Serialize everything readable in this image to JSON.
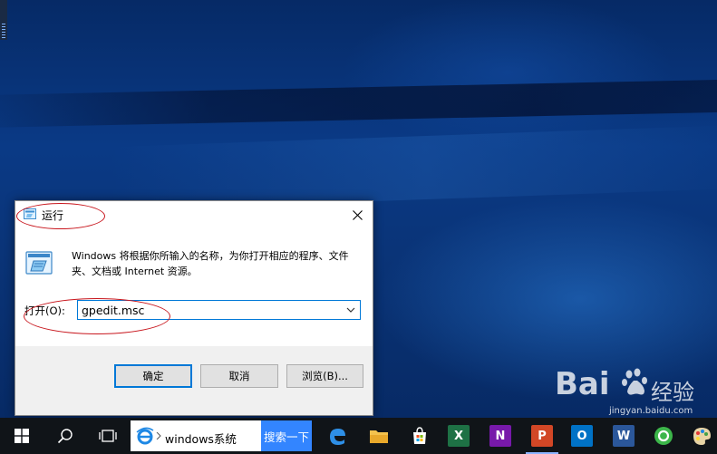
{
  "dialog": {
    "title": "运行",
    "description": "Windows 将根据你所输入的名称，为你打开相应的程序、文件夹、文档或 Internet 资源。",
    "open_label": "打开(O):",
    "command_value": "gpedit.msc",
    "buttons": {
      "ok": "确定",
      "cancel": "取消",
      "browse": "浏览(B)..."
    }
  },
  "taskbar": {
    "search_text": "windows系统",
    "search_button": "搜索一下",
    "apps": [
      {
        "name": "excel",
        "letter": "X",
        "color": "#1e7145"
      },
      {
        "name": "onenote",
        "letter": "N",
        "color": "#7719aa"
      },
      {
        "name": "powerpoint",
        "letter": "P",
        "color": "#d24726"
      },
      {
        "name": "outlook",
        "letter": "O",
        "color": "#0072c6"
      },
      {
        "name": "word",
        "letter": "W",
        "color": "#2b579a"
      }
    ]
  },
  "watermark": {
    "brand": "Bai",
    "cn": "经验",
    "url": "jingyan.baidu.com"
  },
  "colors": {
    "accent": "#0078d7",
    "annotation": "#c8161d",
    "search_button": "#3385ff"
  }
}
